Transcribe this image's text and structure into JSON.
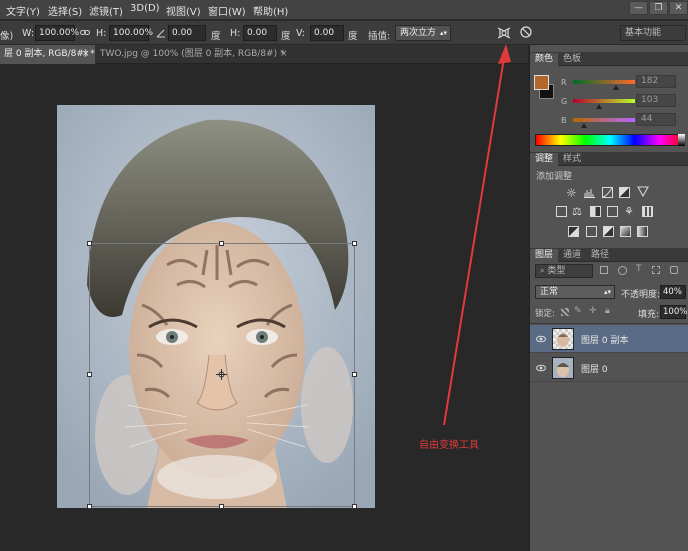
{
  "menubar": {
    "items": [
      "文字(Y)",
      "选择(S)",
      "滤镜(T)",
      "3D(D)",
      "视图(V)",
      "窗口(W)",
      "帮助(H)"
    ],
    "win_minimize": "—",
    "win_restore": "❐",
    "win_close": "✕"
  },
  "options": {
    "left_fragment": "像)",
    "w_label": "W:",
    "w_value": "100.00%",
    "h_label": "H:",
    "h_value": "100.00%",
    "angle_value": "0.00",
    "angle_unit": "度",
    "hskew_label": "H:",
    "hskew_value": "0.00",
    "hskew_unit": "度",
    "vskew_label": "V:",
    "vskew_value": "0.00",
    "vskew_unit": "度",
    "interp_label": "插值:",
    "interp_value": "两次立方",
    "workspace": "基本功能"
  },
  "tabs": [
    {
      "label": "层 0 副本, RGB/8#) *",
      "close": "×"
    },
    {
      "label": "TWO.jpg @ 100% (图层 0 副本, RGB/8#) *",
      "close": "×"
    }
  ],
  "annotation": {
    "text": "自由变换工具",
    "color": "#e03a3a"
  },
  "color_panel": {
    "tabs": [
      "颜色",
      "色板"
    ],
    "foreground": "#b4672c",
    "background": "#111111",
    "channels": [
      {
        "label": "R",
        "value": "182",
        "fraction": 0.71
      },
      {
        "label": "G",
        "value": "103",
        "fraction": 0.4
      },
      {
        "label": "B",
        "value": "44",
        "fraction": 0.17
      }
    ]
  },
  "adjust_panel": {
    "tabs": [
      "调整",
      "样式"
    ],
    "header": "添加调整"
  },
  "layers_panel": {
    "tabs": [
      "图层",
      "通道",
      "路径"
    ],
    "filter_label": "类型",
    "blend_mode": "正常",
    "opacity_label": "不透明度:",
    "opacity_value": "40%",
    "lock_label": "锁定:",
    "fill_label": "填充:",
    "fill_value": "100%",
    "layers": [
      {
        "name": "图层 0 副本",
        "selected": true
      },
      {
        "name": "图层 0",
        "selected": false
      }
    ]
  }
}
